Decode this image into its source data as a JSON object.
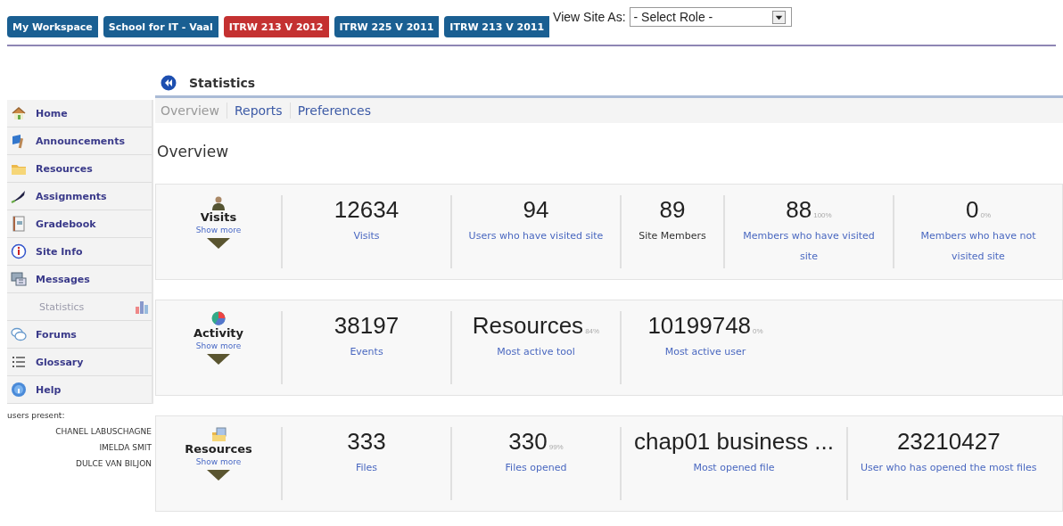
{
  "site_tabs": [
    {
      "label": "My Workspace",
      "selected": false
    },
    {
      "label": "School for IT - Vaal",
      "selected": false
    },
    {
      "label": "ITRW 213 V 2012",
      "selected": true
    },
    {
      "label": "ITRW 225 V 2011",
      "selected": false
    },
    {
      "label": "ITRW 213 V 2011",
      "selected": false
    }
  ],
  "view_site_as": {
    "label": "View Site As:",
    "value": "- Select Role -"
  },
  "sidebar": {
    "items": [
      {
        "label": "Home",
        "selected": false
      },
      {
        "label": "Announcements",
        "selected": false
      },
      {
        "label": "Resources",
        "selected": false
      },
      {
        "label": "Assignments",
        "selected": false
      },
      {
        "label": "Gradebook",
        "selected": false
      },
      {
        "label": "Site Info",
        "selected": false
      },
      {
        "label": "Messages",
        "selected": false
      },
      {
        "label": "Statistics",
        "selected": true
      },
      {
        "label": "Forums",
        "selected": false
      },
      {
        "label": "Glossary",
        "selected": false
      },
      {
        "label": "Help",
        "selected": false
      }
    ],
    "users_present": {
      "title": "users present:",
      "names": [
        "CHANEL LABUSCHAGNE",
        "IMELDA SMIT",
        "DULCE VAN BILJON"
      ]
    }
  },
  "tool": {
    "title": "Statistics",
    "subnav": [
      {
        "label": "Overview",
        "selected": true
      },
      {
        "label": "Reports",
        "selected": false
      },
      {
        "label": "Preferences",
        "selected": false
      }
    ],
    "heading": "Overview",
    "sections": [
      {
        "title": "Visits",
        "show_more": "Show more",
        "stats": [
          {
            "value": "12634",
            "label": "Visits",
            "kind": "link"
          },
          {
            "value": "94",
            "label": "Users who have visited site",
            "kind": "link"
          },
          {
            "value": "89",
            "label": "Site Members",
            "kind": "plain"
          },
          {
            "value": "88",
            "percent": "100%",
            "label": "Members who have visited site",
            "kind": "link"
          },
          {
            "value": "0",
            "percent": "0%",
            "label": "Members who have not visited site",
            "kind": "link"
          }
        ]
      },
      {
        "title": "Activity",
        "show_more": "Show more",
        "stats": [
          {
            "value": "38197",
            "label": "Events",
            "kind": "link"
          },
          {
            "value": "Resources",
            "percent": "84%",
            "label": "Most active tool",
            "kind": "link"
          },
          {
            "value": "10199748",
            "percent": "0%",
            "label": "Most active user",
            "kind": "link"
          }
        ]
      },
      {
        "title": "Resources",
        "show_more": "Show more",
        "stats": [
          {
            "value": "333",
            "label": "Files",
            "kind": "link"
          },
          {
            "value": "330",
            "percent": "99%",
            "label": "Files opened",
            "kind": "link"
          },
          {
            "value": "chap01 business ...",
            "label": "Most opened file",
            "kind": "link"
          },
          {
            "value": "23210427",
            "label": "User who has opened the most files",
            "kind": "link"
          }
        ]
      }
    ]
  }
}
